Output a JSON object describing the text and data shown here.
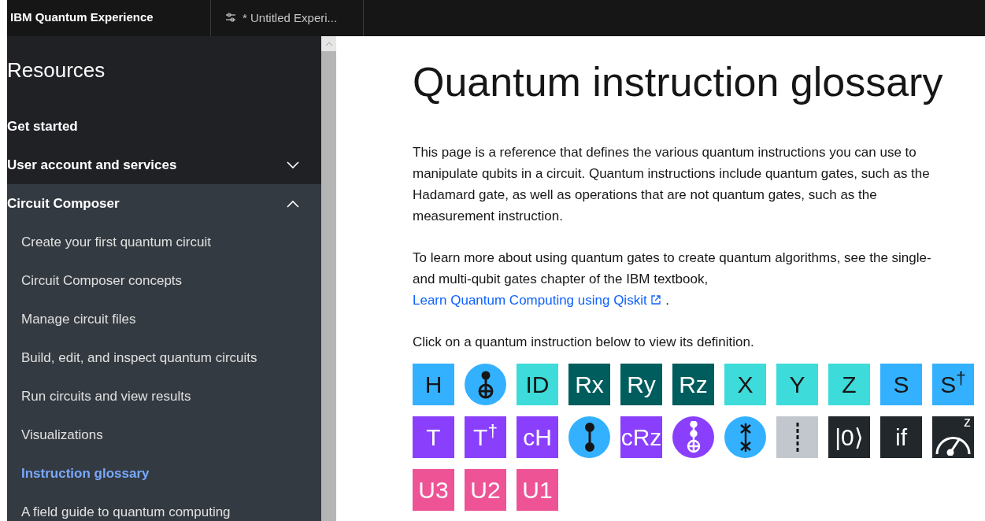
{
  "top_bar": {
    "app_title": "IBM Quantum Experience",
    "tab": {
      "label": "* Untitled Experi...",
      "selected": true
    }
  },
  "sidebar": {
    "title": "Resources",
    "sections": [
      {
        "label": "Get started"
      },
      {
        "label": "User account and services",
        "expanded": false
      },
      {
        "label": "Circuit Composer",
        "expanded": true,
        "children": [
          {
            "label": "Create your first quantum circuit",
            "selected": false
          },
          {
            "label": "Circuit Composer concepts",
            "selected": false
          },
          {
            "label": "Manage circuit files",
            "selected": false
          },
          {
            "label": "Build, edit, and inspect quantum circuits",
            "selected": false
          },
          {
            "label": "Run circuits and view results",
            "selected": false
          },
          {
            "label": "Visualizations",
            "selected": false
          },
          {
            "label": "Instruction glossary",
            "selected": true
          },
          {
            "label": "A field guide to quantum computing",
            "selected": false
          }
        ]
      }
    ]
  },
  "content": {
    "title": "Quantum instruction glossary",
    "paragraphs": [
      "This page is a reference that defines the various quantum instructions you can use to manipulate qubits in a circuit. Quantum instructions include quantum gates, such as the Hadamard gate, as well as operations that are not quantum gates, such as the measurement instruction."
    ],
    "learn_more": {
      "text": "To learn more about using quantum gates to create quantum algorithms, see the single- and multi-qubit gates chapter of the IBM textbook,",
      "link": "Learn Quantum Computing using Qiskit",
      "after": "."
    },
    "instruction": "Click on a quantum instruction below to view its definition.",
    "gates": [
      {
        "kind": "label",
        "label": "H",
        "color": "#33b1ff"
      },
      {
        "kind": "cnot",
        "color": "#33b1ff"
      },
      {
        "kind": "label",
        "label": "ID",
        "color": "#3ddbd9"
      },
      {
        "kind": "label",
        "label": "Rx",
        "color": "#005d5d"
      },
      {
        "kind": "label",
        "label": "Ry",
        "color": "#005d5d"
      },
      {
        "kind": "label",
        "label": "Rz",
        "color": "#005d5d"
      },
      {
        "kind": "label",
        "label": "X",
        "color": "#3ddbd9"
      },
      {
        "kind": "label",
        "label": "Y",
        "color": "#3ddbd9"
      },
      {
        "kind": "label",
        "label": "Z",
        "color": "#3ddbd9"
      },
      {
        "kind": "label",
        "label": "S",
        "color": "#33b1ff"
      },
      {
        "kind": "label",
        "label": "S$^{†}$",
        "color": "#33b1ff"
      },
      {
        "kind": "label",
        "label": "T",
        "color": "#8a3ffc"
      },
      {
        "kind": "label",
        "label": "T$^{†}$",
        "color": "#8a3ffc"
      },
      {
        "kind": "label",
        "label": "cH",
        "color": "#8a3ffc"
      },
      {
        "kind": "cz",
        "color": "#33b1ff"
      },
      {
        "kind": "label",
        "label": "cRz",
        "color": "#8a3ffc"
      },
      {
        "kind": "toffoli",
        "color": "#8a3ffc"
      },
      {
        "kind": "swap",
        "color": "#33b1ff"
      },
      {
        "kind": "barrier",
        "color": "#c1c7cd"
      },
      {
        "kind": "label",
        "label": "|0⟩",
        "color": "#21272a"
      },
      {
        "kind": "label",
        "label": "if",
        "color": "#21272a"
      },
      {
        "kind": "measure",
        "label": "z",
        "color": "#21272a"
      },
      {
        "kind": "label",
        "label": "U3",
        "color": "#ee5396"
      },
      {
        "kind": "label",
        "label": "U2",
        "color": "#ee5396"
      },
      {
        "kind": "label",
        "label": "U1",
        "color": "#ee5396"
      }
    ]
  }
}
